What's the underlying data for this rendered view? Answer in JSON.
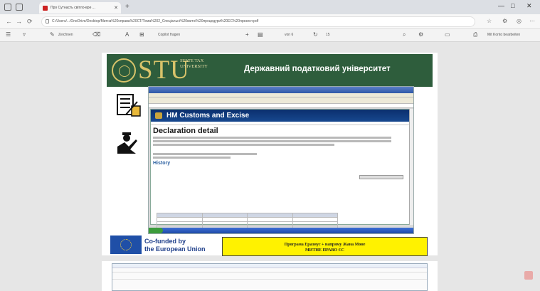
{
  "browser": {
    "tab_title": "Про Сутнасть світло-вре ...",
    "url": "C:/Users/.../OneDrive/Desktop/Митна%20справа%20СТ/Тема%202_Спеціальні%20митні%20процедури%20ЕС%20презент.pdf"
  },
  "pdf_toolbar": {
    "draw_label": "Zeichnen",
    "copilot_label": "Copilot fragen",
    "page_of": "von 6",
    "page_count": "15",
    "account_label": "Mit Konto bearbeiten"
  },
  "slide": {
    "logo_text": "STU",
    "logo_sub": "STATE TAX UNIVERSITY",
    "banner_title": "Державний податковий університет",
    "screenshot": {
      "site_title": "HM Customs and Excise",
      "page_heading": "Declaration detail",
      "history_heading": "History"
    },
    "eu_text_line1": "Co-funded by",
    "eu_text_line2": "the European Union",
    "programme_line1": "Програма Еразмус + напряму Жана Моне",
    "programme_line2": "МИТНЕ ПРАВО ЄС"
  }
}
